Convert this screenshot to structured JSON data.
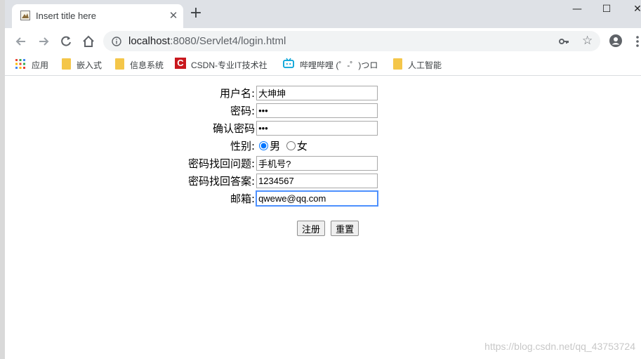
{
  "browser": {
    "tab_title": "Insert title here",
    "tab_close": "✕",
    "new_tab": "+",
    "window_minimize": "—",
    "window_maximize": "☐",
    "window_close": "✕",
    "url_host": "localhost",
    "url_rest": ":8080/Servlet4/login.html"
  },
  "bookmarks": [
    {
      "label": "应用",
      "icon": "apps-icon"
    },
    {
      "label": "嵌入式",
      "icon": "folder-icon"
    },
    {
      "label": "信息系统",
      "icon": "folder-icon"
    },
    {
      "label": "CSDN-专业IT技术社",
      "icon": "csdn-icon"
    },
    {
      "label": "哔哩哔哩 (゜-゜)つロ",
      "icon": "bilibili-icon"
    },
    {
      "label": "人工智能",
      "icon": "folder-icon"
    }
  ],
  "form": {
    "username_label": "用户名:",
    "username_value": "大坤坤",
    "password_label": "密码:",
    "password_value": "•••",
    "confirm_label": "确认密码",
    "confirm_value": "•••",
    "gender_label": "性别:",
    "gender_male": "男",
    "gender_female": "女",
    "question_label": "密码找回问题:",
    "question_value": "手机号?",
    "answer_label": "密码找回答案:",
    "answer_value": "1234567",
    "email_label": "邮箱:",
    "email_value": "qwewe@qq.com",
    "submit_label": "注册",
    "reset_label": "重置"
  },
  "watermark": "https://blog.csdn.net/qq_43753724",
  "colors": {
    "tabbar": "#dee1e6",
    "omnibox": "#f1f3f4",
    "folder": "#f4c649",
    "csdn": "#c9181e",
    "focus": "#4d90fe"
  }
}
